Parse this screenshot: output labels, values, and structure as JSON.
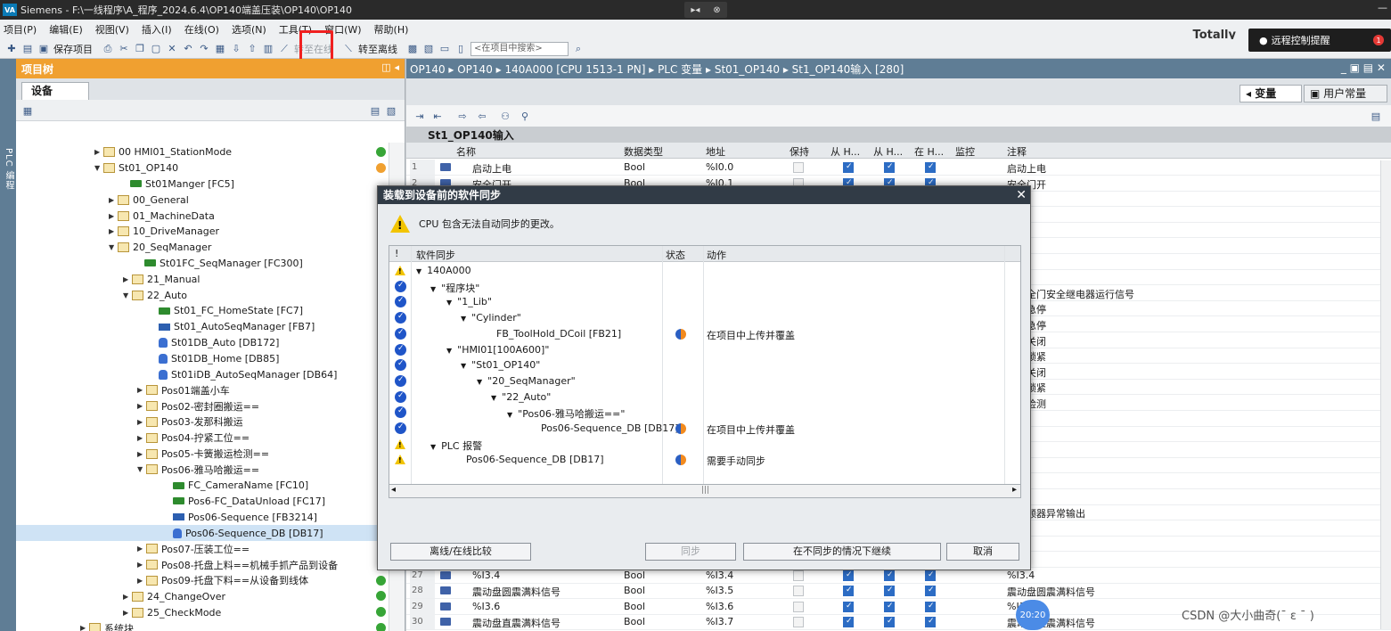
{
  "window": {
    "logo": "VA",
    "title": "Siemens - F:\\一线程序\\A_程序_2024.6.4\\OP140端盖压装\\OP140\\OP140",
    "center_a": "▸◂",
    "center_b": "⊗",
    "minimize": "—"
  },
  "menu": {
    "items": [
      "项目(P)",
      "编辑(E)",
      "视图(V)",
      "插入(I)",
      "在线(O)",
      "选项(N)",
      "工具(T)",
      "窗口(W)",
      "帮助(H)"
    ],
    "brand": "Totally"
  },
  "toolbar": {
    "save_project": "保存项目",
    "go_online": "转至在线",
    "go_offline": "转至离线",
    "search_placeholder": "<在项目中搜索>"
  },
  "remote": {
    "label": "远程控制提醒",
    "count": "1"
  },
  "left_strip": "PLC 编程",
  "tree": {
    "title": "项目树",
    "tab": "设备",
    "rows": [
      {
        "indent": 88,
        "arrow": "▶",
        "icon": "folder",
        "label": "00 HMI01_StationMode",
        "dot": "ok"
      },
      {
        "indent": 88,
        "arrow": "▼",
        "icon": "folder",
        "label": "St01_OP140",
        "dot": "warn"
      },
      {
        "indent": 118,
        "arrow": "",
        "icon": "fc",
        "label": "St01Manger [FC5]",
        "dot": ""
      },
      {
        "indent": 104,
        "arrow": "▶",
        "icon": "folder",
        "label": "00_General",
        "dot": ""
      },
      {
        "indent": 104,
        "arrow": "▶",
        "icon": "folder",
        "label": "01_MachineData",
        "dot": ""
      },
      {
        "indent": 104,
        "arrow": "▶",
        "icon": "folder",
        "label": "10_DriveManager",
        "dot": ""
      },
      {
        "indent": 104,
        "arrow": "▼",
        "icon": "folder",
        "label": "20_SeqManager",
        "dot": ""
      },
      {
        "indent": 134,
        "arrow": "",
        "icon": "fc",
        "label": "St01FC_SeqManager [FC300]",
        "dot": ""
      },
      {
        "indent": 120,
        "arrow": "▶",
        "icon": "folder",
        "label": "21_Manual",
        "dot": ""
      },
      {
        "indent": 120,
        "arrow": "▼",
        "icon": "folder",
        "label": "22_Auto",
        "dot": ""
      },
      {
        "indent": 150,
        "arrow": "",
        "icon": "fc",
        "label": "St01_FC_HomeState [FC7]",
        "dot": ""
      },
      {
        "indent": 150,
        "arrow": "",
        "icon": "fb",
        "label": "St01_AutoSeqManager [FB7]",
        "dot": ""
      },
      {
        "indent": 150,
        "arrow": "",
        "icon": "db",
        "label": "St01DB_Auto [DB172]",
        "dot": ""
      },
      {
        "indent": 150,
        "arrow": "",
        "icon": "db",
        "label": "St01DB_Home [DB85]",
        "dot": ""
      },
      {
        "indent": 150,
        "arrow": "",
        "icon": "db",
        "label": "St01iDB_AutoSeqManager [DB64]",
        "dot": ""
      },
      {
        "indent": 136,
        "arrow": "▶",
        "icon": "folder",
        "label": "Pos01端盖小车",
        "dot": ""
      },
      {
        "indent": 136,
        "arrow": "▶",
        "icon": "folder",
        "label": "Pos02-密封圈搬运==",
        "dot": ""
      },
      {
        "indent": 136,
        "arrow": "▶",
        "icon": "folder",
        "label": "Pos03-发那科搬运",
        "dot": ""
      },
      {
        "indent": 136,
        "arrow": "▶",
        "icon": "folder",
        "label": "Pos04-拧紧工位==",
        "dot": ""
      },
      {
        "indent": 136,
        "arrow": "▶",
        "icon": "folder",
        "label": "Pos05-卡簧搬运检测==",
        "dot": ""
      },
      {
        "indent": 136,
        "arrow": "▼",
        "icon": "folder",
        "label": "Pos06-雅马哈搬运==",
        "dot": ""
      },
      {
        "indent": 166,
        "arrow": "",
        "icon": "fc",
        "label": "FC_CameraName [FC10]",
        "dot": ""
      },
      {
        "indent": 166,
        "arrow": "",
        "icon": "fc",
        "label": "Pos6-FC_DataUnload [FC17]",
        "dot": ""
      },
      {
        "indent": 166,
        "arrow": "",
        "icon": "fb",
        "label": "Pos06-Sequence [FB3214]",
        "dot": ""
      },
      {
        "indent": 166,
        "arrow": "",
        "icon": "db",
        "label": "Pos06-Sequence_DB [DB17]",
        "dot": "",
        "selected": true
      },
      {
        "indent": 136,
        "arrow": "▶",
        "icon": "folder",
        "label": "Pos07-压装工位==",
        "dot": ""
      },
      {
        "indent": 136,
        "arrow": "▶",
        "icon": "folder",
        "label": "Pos08-托盘上料==机械手抓产品到设备",
        "dot": ""
      },
      {
        "indent": 136,
        "arrow": "▶",
        "icon": "folder",
        "label": "Pos09-托盘下料==从设备到线体",
        "dot": "ok"
      },
      {
        "indent": 120,
        "arrow": "▶",
        "icon": "folder",
        "label": "24_ChangeOver",
        "dot": "ok"
      },
      {
        "indent": 120,
        "arrow": "▶",
        "icon": "folder",
        "label": "25_CheckMode",
        "dot": "ok"
      },
      {
        "indent": 72,
        "arrow": "▶",
        "icon": "folder",
        "label": "系统块",
        "dot": "ok"
      }
    ]
  },
  "breadcrumb": "OP140 ▸ OP140 ▸ 140A000 [CPU 1513-1 PN] ▸ PLC 变量 ▸ St01_OP140 ▸ St1_OP140输入 [280]",
  "right_tabs": {
    "variables": "变量",
    "user_constants": "用户常量"
  },
  "table": {
    "title": "St1_OP140输入",
    "headers": {
      "name": "名称",
      "type": "数据类型",
      "address": "地址",
      "retain": "保持",
      "from_h1": "从 H...",
      "from_h2": "从 H...",
      "in_h": "在 H...",
      "monitor": "监控",
      "comment": "注释"
    },
    "rows": [
      {
        "num": "1",
        "name": "启动上电",
        "type": "Bool",
        "addr": "%I0.0",
        "comment": "启动上电"
      },
      {
        "num": "2",
        "name": "安全门开",
        "type": "Bool",
        "addr": "%I0.1",
        "comment": "安全门开"
      },
      {
        "num": "",
        "name": "",
        "type": "",
        "addr": "",
        "comment": "门关"
      },
      {
        "num": "",
        "name": "",
        "type": "",
        "addr": "",
        "comment": "复位"
      },
      {
        "num": "",
        "name": "",
        "type": "",
        "addr": "",
        "comment": "钮"
      },
      {
        "num": "",
        "name": "",
        "type": "",
        "addr": "",
        "comment": "点"
      },
      {
        "num": "",
        "name": "",
        "type": "",
        "addr": "",
        "comment": ""
      },
      {
        "num": "",
        "name": "",
        "type": "",
        "addr": "",
        "comment": "急停"
      },
      {
        "num": "",
        "name": "",
        "type": "",
        "addr": "",
        "comment": "和安全门安全继电器运行信号"
      },
      {
        "num": "",
        "name": "",
        "type": "",
        "addr": "",
        "comment": "设备急停"
      },
      {
        "num": "",
        "name": "",
        "type": "",
        "addr": "",
        "comment": "设备急停"
      },
      {
        "num": "",
        "name": "",
        "type": "",
        "addr": "",
        "comment": "全门关闭"
      },
      {
        "num": "",
        "name": "",
        "type": "",
        "addr": "",
        "comment": "全门锁紧"
      },
      {
        "num": "",
        "name": "",
        "type": "",
        "addr": "",
        "comment": "全门关闭"
      },
      {
        "num": "",
        "name": "",
        "type": "",
        "addr": "",
        "comment": "全门锁紧"
      },
      {
        "num": "",
        "name": "",
        "type": "",
        "addr": "",
        "comment": "压力检测"
      },
      {
        "num": "",
        "name": "",
        "type": "",
        "addr": "",
        "comment": ""
      },
      {
        "num": "",
        "name": "",
        "type": "",
        "addr": "",
        "comment": ""
      },
      {
        "num": "",
        "name": "",
        "type": "",
        "addr": "",
        "comment": ""
      },
      {
        "num": "",
        "name": "",
        "type": "",
        "addr": "",
        "comment": ""
      },
      {
        "num": "",
        "name": "",
        "type": "",
        "addr": "",
        "comment": ""
      },
      {
        "num": "",
        "name": "",
        "type": "",
        "addr": "",
        "comment": ""
      },
      {
        "num": "",
        "name": "",
        "type": "",
        "addr": "",
        "comment": "滚变频器异常输出"
      },
      {
        "num": "",
        "name": "",
        "type": "",
        "addr": "",
        "comment": ""
      },
      {
        "num": "",
        "name": "",
        "type": "",
        "addr": "",
        "comment": ""
      },
      {
        "num": "",
        "name": "",
        "type": "",
        "addr": "",
        "comment": ""
      },
      {
        "num": "27",
        "name": "%I3.4",
        "type": "Bool",
        "addr": "%I3.4",
        "comment": "%I3.4"
      },
      {
        "num": "28",
        "name": "震动盘圆震满料信号",
        "type": "Bool",
        "addr": "%I3.5",
        "comment": "震动盘圆震满料信号"
      },
      {
        "num": "29",
        "name": "%I3.6",
        "type": "Bool",
        "addr": "%I3.6",
        "comment": "%I3.6"
      },
      {
        "num": "30",
        "name": "震动盘直震满料信号",
        "type": "Bool",
        "addr": "%I3.7",
        "comment": "震动盘直震满料信号"
      }
    ]
  },
  "dialog": {
    "title": "装载到设备前的软件同步",
    "close": "✕",
    "message": "CPU 包含无法自动同步的更改。",
    "headers": {
      "excl": "!",
      "sync": "软件同步",
      "status": "状态",
      "action": "动作"
    },
    "rows": [
      {
        "state": "warn",
        "indent": 30,
        "arrow": "▼",
        "name": "140A000",
        "sync": false,
        "action": ""
      },
      {
        "state": "ok",
        "indent": 46,
        "arrow": "▼",
        "name": "\"程序块\"",
        "sync": false,
        "action": ""
      },
      {
        "state": "ok",
        "indent": 64,
        "arrow": "▼",
        "name": "\"1_Lib\"",
        "sync": false,
        "action": ""
      },
      {
        "state": "ok",
        "indent": 80,
        "arrow": "▼",
        "name": "\"Cylinder\"",
        "sync": false,
        "action": ""
      },
      {
        "state": "ok",
        "indent": 114,
        "arrow": "",
        "name": "FB_ToolHold_DCoil [FB21]",
        "sync": true,
        "action": "在项目中上传并覆盖"
      },
      {
        "state": "ok",
        "indent": 64,
        "arrow": "▼",
        "name": "\"HMI01[100A600]\"",
        "sync": false,
        "action": ""
      },
      {
        "state": "ok",
        "indent": 80,
        "arrow": "▼",
        "name": "\"St01_OP140\"",
        "sync": false,
        "action": ""
      },
      {
        "state": "ok",
        "indent": 98,
        "arrow": "▼",
        "name": "\"20_SeqManager\"",
        "sync": false,
        "action": ""
      },
      {
        "state": "ok",
        "indent": 114,
        "arrow": "▼",
        "name": "\"22_Auto\"",
        "sync": false,
        "action": ""
      },
      {
        "state": "ok",
        "indent": 132,
        "arrow": "▼",
        "name": "\"Pos06-雅马哈搬运==\"",
        "sync": false,
        "action": ""
      },
      {
        "state": "ok",
        "indent": 164,
        "arrow": "",
        "name": "Pos06-Sequence_DB [DB17]",
        "sync": true,
        "action": "在项目中上传并覆盖"
      },
      {
        "state": "warn",
        "indent": 46,
        "arrow": "▼",
        "name": "PLC 报警",
        "sync": false,
        "action": ""
      },
      {
        "state": "warn",
        "indent": 80,
        "arrow": "",
        "name": "Pos06-Sequence_DB [DB17]",
        "sync": true,
        "action": "需要手动同步"
      }
    ],
    "scroll_mid": "|||",
    "buttons": {
      "compare": "离线/在线比较",
      "sync": "同步",
      "continue": "在不同步的情况下继续",
      "cancel": "取消"
    }
  },
  "clock": "20:20",
  "watermark": "CSDN @大小曲奇(ˉ ε ˉ )"
}
